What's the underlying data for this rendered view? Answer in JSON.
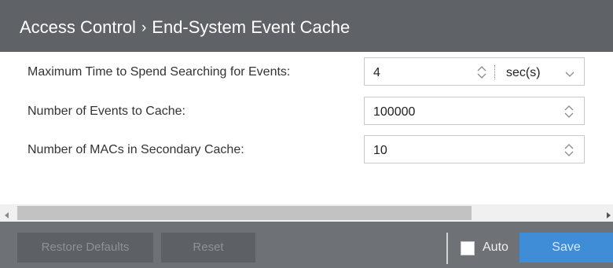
{
  "header": {
    "section": "Access Control",
    "separator": "›",
    "page": "End-System Event Cache"
  },
  "fields": [
    {
      "label": "Maximum Time to Spend Searching for Events:",
      "value": "4",
      "unit": "sec(s)"
    },
    {
      "label": "Number of Events to Cache:",
      "value": "100000"
    },
    {
      "label": "Number of MACs in Secondary Cache:",
      "value": "10"
    }
  ],
  "footer": {
    "restore_defaults_label": "Restore Defaults",
    "reset_label": "Reset",
    "auto_label": "Auto",
    "auto_checked": false,
    "save_label": "Save"
  },
  "colors": {
    "header_bg": "#5f6368",
    "footer_bg": "#6e7175",
    "save_accent": "#3e8dd6"
  }
}
